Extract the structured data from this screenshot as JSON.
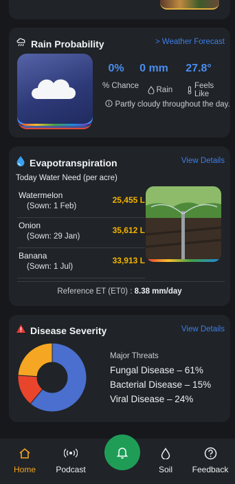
{
  "rain": {
    "title": "Rain Probability",
    "link": "> Weather Forecast",
    "chance_value": "0%",
    "rain_value": "0 mm",
    "feels_value": "27.8°",
    "chance_label": "% Chance",
    "rain_label": "Rain",
    "feels_label": "Feels Like",
    "description": "Partly cloudy throughout the day."
  },
  "et": {
    "title": "Evapotranspiration",
    "link": "View Details",
    "subtitle": "Today Water Need (per acre)",
    "crops": [
      {
        "name": "Watermelon",
        "sown": "(Sown: 1 Feb)",
        "value": "25,455 L"
      },
      {
        "name": "Onion",
        "sown": "(Sown: 29 Jan)",
        "value": "35,612 L"
      },
      {
        "name": "Banana",
        "sown": "(Sown: 1 Jul)",
        "value": "33,913 L"
      }
    ],
    "ref_label": "Reference ET (ET0) :",
    "ref_value": "8.38 mm/day"
  },
  "disease": {
    "title": "Disease Severity",
    "link": "View Details",
    "threats_title": "Major Threats",
    "threats": [
      "Fungal Disease – 61%",
      "Bacterial Disease – 15%",
      "Viral Disease – 24%"
    ],
    "chart_data": {
      "type": "pie",
      "categories": [
        "Fungal Disease",
        "Bacterial Disease",
        "Viral Disease"
      ],
      "values": [
        61,
        15,
        24
      ],
      "colors": [
        "#4a6fcf",
        "#e8452c",
        "#f5a623"
      ]
    }
  },
  "nav": {
    "home": "Home",
    "podcast": "Podcast",
    "soil": "Soil",
    "feedback": "Feedback",
    "active_color": "#f5a623"
  }
}
